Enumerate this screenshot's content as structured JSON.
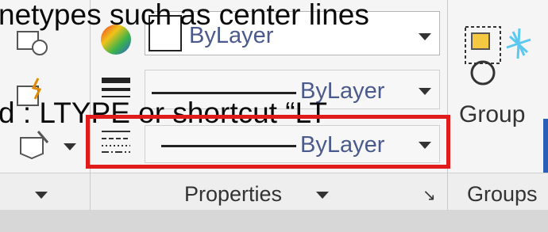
{
  "overlay": {
    "line1": "netypes such as center lines",
    "line2": "d : LTYPE or  shortcut “LT"
  },
  "properties_panel": {
    "color_dropdown": {
      "value": "ByLayer"
    },
    "lineweight_dropdown": {
      "value": "ByLayer"
    },
    "linetype_dropdown": {
      "value": "ByLayer"
    },
    "panel_label": "Properties"
  },
  "groups_panel": {
    "group_button_label": "Group",
    "panel_label": "Groups"
  },
  "highlight_color": "#e01b1b"
}
